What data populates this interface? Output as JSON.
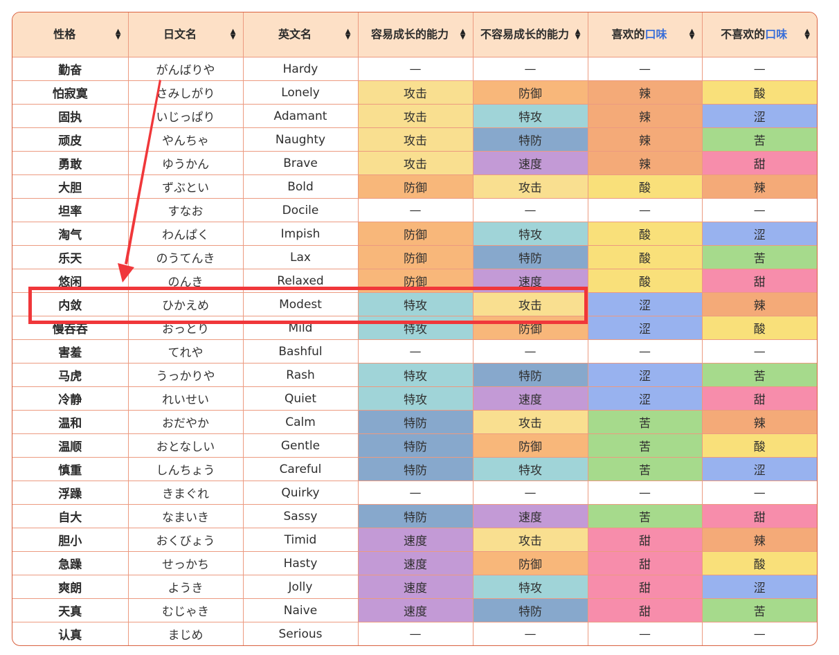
{
  "colors": {
    "header_bg": "#fde0c6",
    "border": "#ec9a80",
    "accent_text": "#3b6fd8",
    "annotation_red": "#f0373a",
    "stat": {
      "攻击": "#f9df90",
      "防御": "#f8b77a",
      "特攻": "#a0d4d8",
      "特防": "#87a8cc",
      "速度": "#c39ad6"
    },
    "flavor": {
      "辣": "#f4aa78",
      "酸": "#f9e07a",
      "涩": "#98b2ef",
      "苦": "#a6da8c",
      "甜": "#f78dab"
    }
  },
  "table": {
    "headers": [
      {
        "label": "性格",
        "accent": ""
      },
      {
        "label": "日文名",
        "accent": ""
      },
      {
        "label": "英文名",
        "accent": ""
      },
      {
        "label": "容易成长的能力",
        "accent": ""
      },
      {
        "label": "不容易成长的能力",
        "accent": ""
      },
      {
        "label": "喜欢的",
        "accent": "口味"
      },
      {
        "label": "不喜欢的",
        "accent": "口味"
      }
    ],
    "sort_icon": "↕",
    "rows": [
      {
        "name": "勤奋",
        "jp": "がんばりや",
        "en": "Hardy",
        "up": "—",
        "down": "—",
        "like": "—",
        "dislike": "—"
      },
      {
        "name": "怕寂寞",
        "jp": "さみしがり",
        "en": "Lonely",
        "up": "攻击",
        "down": "防御",
        "like": "辣",
        "dislike": "酸"
      },
      {
        "name": "固执",
        "jp": "いじっぱり",
        "en": "Adamant",
        "up": "攻击",
        "down": "特攻",
        "like": "辣",
        "dislike": "涩"
      },
      {
        "name": "顽皮",
        "jp": "やんちゃ",
        "en": "Naughty",
        "up": "攻击",
        "down": "特防",
        "like": "辣",
        "dislike": "苦"
      },
      {
        "name": "勇敢",
        "jp": "ゆうかん",
        "en": "Brave",
        "up": "攻击",
        "down": "速度",
        "like": "辣",
        "dislike": "甜"
      },
      {
        "name": "大胆",
        "jp": "ずぶとい",
        "en": "Bold",
        "up": "防御",
        "down": "攻击",
        "like": "酸",
        "dislike": "辣"
      },
      {
        "name": "坦率",
        "jp": "すなお",
        "en": "Docile",
        "up": "—",
        "down": "—",
        "like": "—",
        "dislike": "—"
      },
      {
        "name": "淘气",
        "jp": "わんぱく",
        "en": "Impish",
        "up": "防御",
        "down": "特攻",
        "like": "酸",
        "dislike": "涩"
      },
      {
        "name": "乐天",
        "jp": "のうてんき",
        "en": "Lax",
        "up": "防御",
        "down": "特防",
        "like": "酸",
        "dislike": "苦"
      },
      {
        "name": "悠闲",
        "jp": "のんき",
        "en": "Relaxed",
        "up": "防御",
        "down": "速度",
        "like": "酸",
        "dislike": "甜"
      },
      {
        "name": "内敛",
        "jp": "ひかえめ",
        "en": "Modest",
        "up": "特攻",
        "down": "攻击",
        "like": "涩",
        "dislike": "辣",
        "highlighted": true
      },
      {
        "name": "慢吞吞",
        "jp": "おっとり",
        "en": "Mild",
        "up": "特攻",
        "down": "防御",
        "like": "涩",
        "dislike": "酸"
      },
      {
        "name": "害羞",
        "jp": "てれや",
        "en": "Bashful",
        "up": "—",
        "down": "—",
        "like": "—",
        "dislike": "—"
      },
      {
        "name": "马虎",
        "jp": "うっかりや",
        "en": "Rash",
        "up": "特攻",
        "down": "特防",
        "like": "涩",
        "dislike": "苦"
      },
      {
        "name": "冷静",
        "jp": "れいせい",
        "en": "Quiet",
        "up": "特攻",
        "down": "速度",
        "like": "涩",
        "dislike": "甜"
      },
      {
        "name": "温和",
        "jp": "おだやか",
        "en": "Calm",
        "up": "特防",
        "down": "攻击",
        "like": "苦",
        "dislike": "辣"
      },
      {
        "name": "温顺",
        "jp": "おとなしい",
        "en": "Gentle",
        "up": "特防",
        "down": "防御",
        "like": "苦",
        "dislike": "酸"
      },
      {
        "name": "慎重",
        "jp": "しんちょう",
        "en": "Careful",
        "up": "特防",
        "down": "特攻",
        "like": "苦",
        "dislike": "涩"
      },
      {
        "name": "浮躁",
        "jp": "きまぐれ",
        "en": "Quirky",
        "up": "—",
        "down": "—",
        "like": "—",
        "dislike": "—"
      },
      {
        "name": "自大",
        "jp": "なまいき",
        "en": "Sassy",
        "up": "特防",
        "down": "速度",
        "like": "苦",
        "dislike": "甜"
      },
      {
        "name": "胆小",
        "jp": "おくびょう",
        "en": "Timid",
        "up": "速度",
        "down": "攻击",
        "like": "甜",
        "dislike": "辣"
      },
      {
        "name": "急躁",
        "jp": "せっかち",
        "en": "Hasty",
        "up": "速度",
        "down": "防御",
        "like": "甜",
        "dislike": "酸"
      },
      {
        "name": "爽朗",
        "jp": "ようき",
        "en": "Jolly",
        "up": "速度",
        "down": "特攻",
        "like": "甜",
        "dislike": "涩"
      },
      {
        "name": "天真",
        "jp": "むじゃき",
        "en": "Naive",
        "up": "速度",
        "down": "特防",
        "like": "甜",
        "dislike": "苦"
      },
      {
        "name": "认真",
        "jp": "まじめ",
        "en": "Serious",
        "up": "—",
        "down": "—",
        "like": "—",
        "dislike": "—"
      }
    ]
  },
  "annotations": {
    "arrow": "arrow-annotation",
    "highlight": "highlight-box-annotation"
  }
}
